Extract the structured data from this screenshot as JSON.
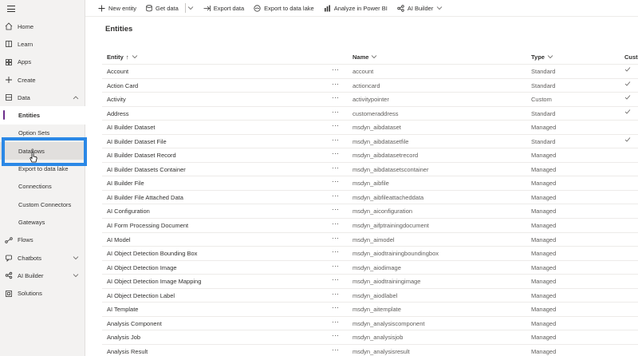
{
  "sidebar": {
    "items": [
      {
        "label": "Home"
      },
      {
        "label": "Learn"
      },
      {
        "label": "Apps"
      },
      {
        "label": "Create"
      },
      {
        "label": "Data"
      },
      {
        "label": "Entities"
      },
      {
        "label": "Option Sets"
      },
      {
        "label": "Dataflows"
      },
      {
        "label": "Export to data lake"
      },
      {
        "label": "Connections"
      },
      {
        "label": "Custom Connectors"
      },
      {
        "label": "Gateways"
      },
      {
        "label": "Flows"
      },
      {
        "label": "Chatbots"
      },
      {
        "label": "AI Builder"
      },
      {
        "label": "Solutions"
      }
    ],
    "selected": "Entities",
    "hovered": "Dataflows"
  },
  "commandbar": {
    "new_entity": "New entity",
    "get_data": "Get data",
    "export_data": "Export data",
    "export_lake": "Export to data lake",
    "analyze": "Analyze in Power BI",
    "ai_builder": "AI Builder"
  },
  "page_title": "Entities",
  "table": {
    "headers": {
      "entity": "Entity",
      "sort": "↑",
      "name": "Name",
      "type": "Type",
      "custom": "Custo"
    },
    "rows": [
      {
        "display": "Account",
        "name": "account",
        "type": "Standard",
        "check": true
      },
      {
        "display": "Action Card",
        "name": "actioncard",
        "type": "Standard",
        "check": true
      },
      {
        "display": "Activity",
        "name": "activitypointer",
        "type": "Custom",
        "check": true
      },
      {
        "display": "Address",
        "name": "customeraddress",
        "type": "Standard",
        "check": true
      },
      {
        "display": "AI Builder Dataset",
        "name": "msdyn_aibdataset",
        "type": "Managed",
        "check": false
      },
      {
        "display": "AI Builder Dataset File",
        "name": "msdyn_aibdatasetfile",
        "type": "Standard",
        "check": true
      },
      {
        "display": "AI Builder Dataset Record",
        "name": "msdyn_aibdatasetrecord",
        "type": "Managed",
        "check": false
      },
      {
        "display": "AI Builder Datasets Container",
        "name": "msdyn_aibdatasetscontainer",
        "type": "Managed",
        "check": false
      },
      {
        "display": "AI Builder File",
        "name": "msdyn_aibfile",
        "type": "Managed",
        "check": false
      },
      {
        "display": "AI Builder File Attached Data",
        "name": "msdyn_aibfileattacheddata",
        "type": "Managed",
        "check": false
      },
      {
        "display": "AI Configuration",
        "name": "msdyn_aiconfiguration",
        "type": "Managed",
        "check": false
      },
      {
        "display": "AI Form Processing Document",
        "name": "msdyn_aifptrainingdocument",
        "type": "Managed",
        "check": false
      },
      {
        "display": "AI Model",
        "name": "msdyn_aimodel",
        "type": "Managed",
        "check": false
      },
      {
        "display": "AI Object Detection Bounding Box",
        "name": "msdyn_aiodtrainingboundingbox",
        "type": "Managed",
        "check": false
      },
      {
        "display": "AI Object Detection Image",
        "name": "msdyn_aiodimage",
        "type": "Managed",
        "check": false
      },
      {
        "display": "AI Object Detection Image Mapping",
        "name": "msdyn_aiodtrainingimage",
        "type": "Managed",
        "check": false
      },
      {
        "display": "AI Object Detection Label",
        "name": "msdyn_aiodlabel",
        "type": "Managed",
        "check": false
      },
      {
        "display": "AI Template",
        "name": "msdyn_aitemplate",
        "type": "Managed",
        "check": false
      },
      {
        "display": "Analysis Component",
        "name": "msdyn_analysiscomponent",
        "type": "Managed",
        "check": false
      },
      {
        "display": "Analysis Job",
        "name": "msdyn_analysisjob",
        "type": "Managed",
        "check": false
      },
      {
        "display": "Analysis Result",
        "name": "msdyn_analysisresult",
        "type": "Managed",
        "check": false
      }
    ]
  },
  "colors": {
    "accent": "#6b2d8a",
    "highlight": "#2b88e6"
  }
}
